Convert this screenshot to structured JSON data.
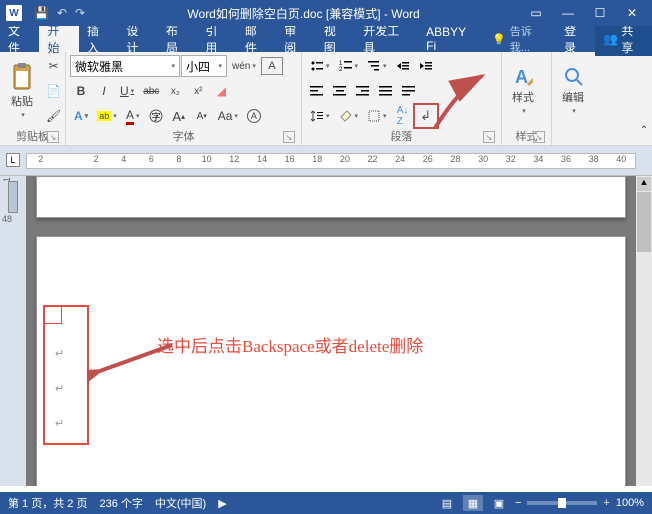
{
  "title": "Word如何删除空白页.doc [兼容模式] - Word",
  "menu": {
    "file": "文件",
    "home": "开始",
    "insert": "插入",
    "design": "设计",
    "layout": "布局",
    "references": "引用",
    "mailings": "邮件",
    "review": "审阅",
    "view": "视图",
    "developer": "开发工具",
    "abbyy": "ABBYY Fi",
    "tellme": "告诉我...",
    "signin": "登录",
    "share": "共享"
  },
  "ribbon": {
    "clipboard": {
      "label": "剪贴板",
      "paste": "粘贴"
    },
    "font": {
      "label": "字体",
      "family": "微软雅黑",
      "size": "小四",
      "bold": "B",
      "italic": "I",
      "underline": "U",
      "strike": "abc",
      "sub": "x₂",
      "sup": "x²",
      "phonetic": "拼",
      "charborder": "A",
      "highlight": "aby",
      "fontcolor": "A",
      "grow": "A",
      "shrink": "A",
      "clear": "Aa",
      "changecase": "A"
    },
    "paragraph": {
      "label": "段落"
    },
    "styles": {
      "label": "样式",
      "btn": "样式"
    },
    "editing": {
      "label": "编辑",
      "btn": "编辑"
    }
  },
  "ruler": {
    "nums": [
      "2",
      "",
      "2",
      "4",
      "6",
      "8",
      "10",
      "12",
      "14",
      "16",
      "18",
      "20",
      "22",
      "24",
      "26",
      "28",
      "30",
      "32",
      "34",
      "36",
      "38",
      "40"
    ],
    "vnum1": "1",
    "vnum2": "48"
  },
  "annotation": "选中后点击Backspace或者delete删除",
  "status": {
    "page": "第 1 页，共 2 页",
    "words": "236 个字",
    "lang": "中文(中国)",
    "zoom": "100%"
  }
}
